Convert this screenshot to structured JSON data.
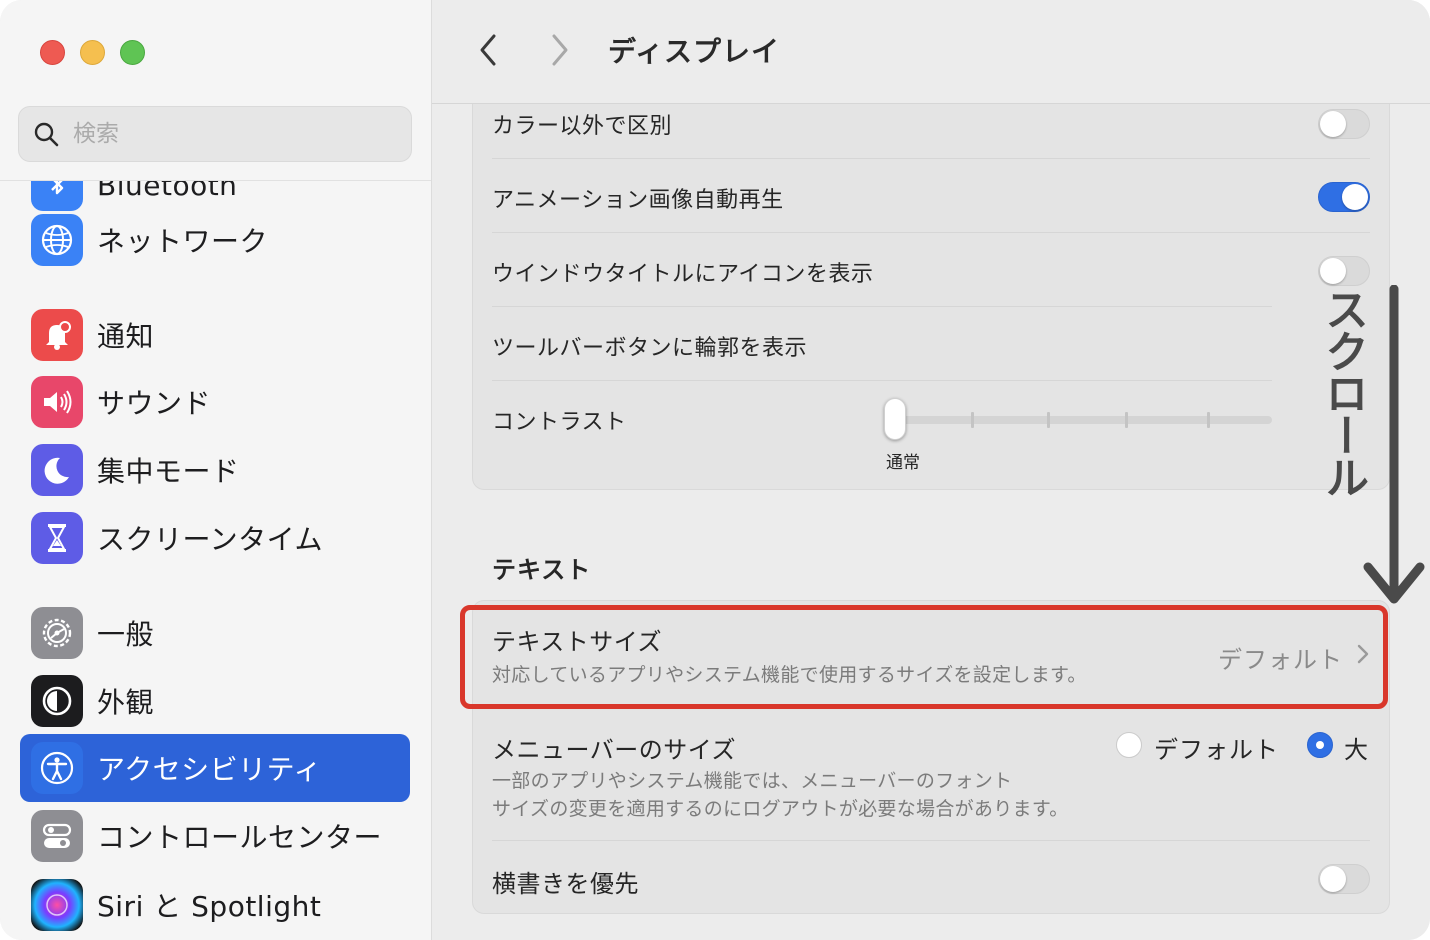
{
  "window": {
    "traffic_lights": [
      "close",
      "minimize",
      "zoom"
    ]
  },
  "sidebar": {
    "search_placeholder": "検索",
    "cut_item_label": "Bluetooth",
    "items": [
      {
        "label": "ネットワーク",
        "icon": "globe-icon",
        "color": "#3a82f6"
      },
      {
        "label": "通知",
        "icon": "bell-icon",
        "color": "#ec4b4b"
      },
      {
        "label": "サウンド",
        "icon": "speaker-icon",
        "color": "#e8476a"
      },
      {
        "label": "集中モード",
        "icon": "moon-icon",
        "color": "#5e5ce6"
      },
      {
        "label": "スクリーンタイム",
        "icon": "hourglass-icon",
        "color": "#5e5ce6"
      },
      {
        "label": "一般",
        "icon": "gear-icon",
        "color": "#8e8e93"
      },
      {
        "label": "外観",
        "icon": "appearance-icon",
        "color": "#1c1c1e"
      },
      {
        "label": "アクセシビリティ",
        "icon": "accessibility-icon",
        "color": "#2f6fe4",
        "active": true
      },
      {
        "label": "コントロールセンター",
        "icon": "control-center-icon",
        "color": "#8e8e93"
      },
      {
        "label": "Siri と Spotlight",
        "icon": "siri-icon",
        "color": "#000000"
      }
    ]
  },
  "toolbar": {
    "title": "ディスプレイ"
  },
  "display_group": {
    "rows": [
      {
        "label": "カラー以外で区別",
        "toggle": false
      },
      {
        "label": "アニメーション画像自動再生",
        "toggle": true
      },
      {
        "label": "ウインドウタイトルにアイコンを表示",
        "toggle": false
      },
      {
        "label": "ツールバーボタンに輪郭を表示",
        "toggle": null
      },
      {
        "label": "コントラスト",
        "toggle": null
      }
    ],
    "contrast": {
      "caption": "通常",
      "level": 0,
      "steps": 5
    }
  },
  "text_section": {
    "title": "テキスト",
    "text_size": {
      "label": "テキストサイズ",
      "description": "対応しているアプリやシステム機能で使用するサイズを設定します。",
      "value": "デフォルト"
    },
    "menubar_size": {
      "label": "メニューバーのサイズ",
      "description_line1": "一部のアプリやシステム機能では、メニューバーのフォント",
      "description_line2": "サイズの変更を適用するのにログアウトが必要な場合があります。",
      "options": [
        {
          "label": "デフォルト",
          "selected": false
        },
        {
          "label": "大",
          "selected": true
        }
      ]
    },
    "horizontal": {
      "label": "横書きを優先",
      "toggle": false
    }
  },
  "annotation": {
    "scroll_text": "スクロール",
    "highlight_color": "#d9372b"
  }
}
